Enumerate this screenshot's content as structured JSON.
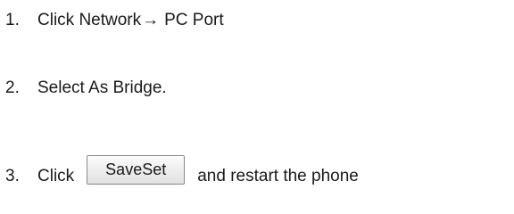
{
  "steps": [
    {
      "number": "1.",
      "text_before": "Click Network",
      "arrow": "→",
      "text_after": "PC Port"
    },
    {
      "number": "2.",
      "text": "Select As Bridge."
    },
    {
      "number": "3.",
      "text_before": "Click",
      "button_label": "SaveSet",
      "text_after": "and restart the phone"
    }
  ]
}
